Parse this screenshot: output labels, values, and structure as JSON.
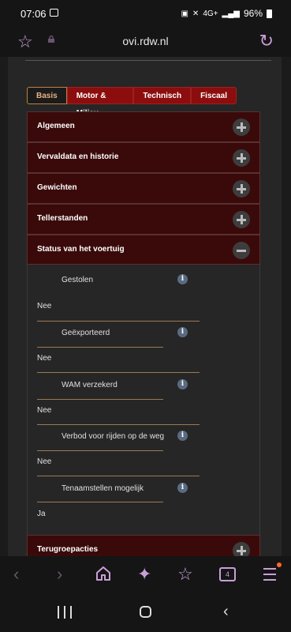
{
  "status_bar": {
    "time": "07:06",
    "network": "4G+",
    "battery": "96%"
  },
  "browser": {
    "url": "ovi.rdw.nl"
  },
  "tabs": [
    {
      "label": "Basis",
      "active": true
    },
    {
      "label": "Motor & Milieu",
      "active": false
    },
    {
      "label": "Technisch",
      "active": false
    },
    {
      "label": "Fiscaal",
      "active": false
    }
  ],
  "sections": [
    {
      "title": "Algemeen",
      "expanded": false
    },
    {
      "title": "Vervaldata en historie",
      "expanded": false
    },
    {
      "title": "Gewichten",
      "expanded": false
    },
    {
      "title": "Tellerstanden",
      "expanded": false
    },
    {
      "title": "Status van het voertuig",
      "expanded": true
    },
    {
      "title": "Terugroepacties",
      "expanded": false
    }
  ],
  "status_rows": [
    {
      "label": "Gestolen",
      "value": "Nee"
    },
    {
      "label": "Geëxporteerd",
      "value": "Nee"
    },
    {
      "label": "WAM verzekerd",
      "value": "Nee"
    },
    {
      "label": "Verbod voor rijden op de weg",
      "value": "Nee"
    },
    {
      "label": "Tenaamstellen mogelijk",
      "value": "Ja"
    }
  ],
  "info_glyph": "i",
  "bottom_nav": {
    "tab_count": "4"
  },
  "colors": {
    "accent": "#c99fd8",
    "tab_red": "#8b0d0d",
    "section_bg": "#3a0a0a"
  }
}
